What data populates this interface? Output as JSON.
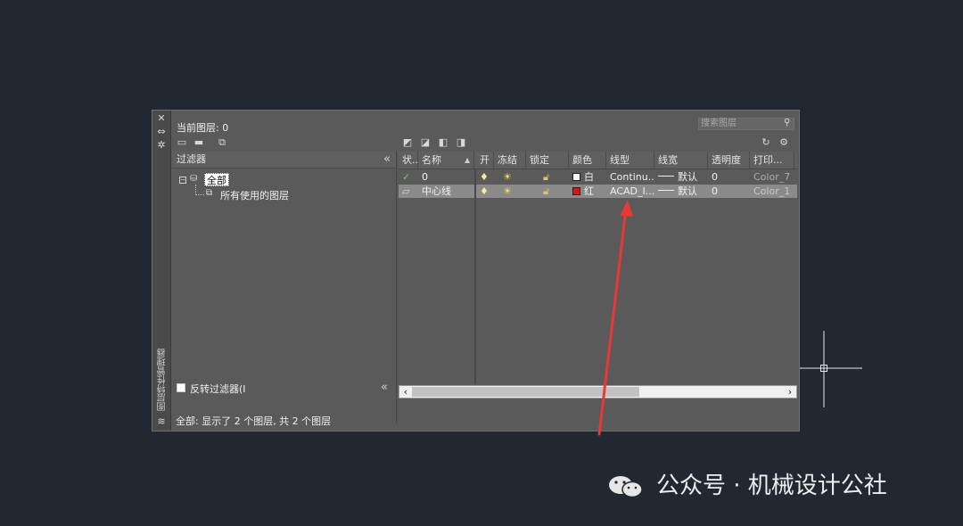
{
  "palette": {
    "title": "图层特性管理器",
    "current_layer": "当前图层: 0",
    "search_placeholder": "搜索图层"
  },
  "filters": {
    "header": "过滤器",
    "tree": {
      "root": "全部",
      "child": "所有使用的图层"
    },
    "invert_label": "反转过滤器(I",
    "invert_checked": false
  },
  "columns": [
    "状...",
    "名称",
    "开",
    "冻结",
    "锁定",
    "颜色",
    "线型",
    "线宽",
    "透明度",
    "打印..."
  ],
  "layers": [
    {
      "status": "current-check-icon",
      "name": "0",
      "on": "lightbulb-on",
      "freeze": "sun-thawed",
      "lock": "unlocked",
      "color_name": "白",
      "color_hex": "#ffffff",
      "linetype": "Continu...",
      "lineweight": "默认",
      "transparency": "0",
      "plot_style": "Color_7"
    },
    {
      "status": "layer-icon",
      "name": "中心线",
      "on": "lightbulb-on",
      "freeze": "sun-thawed",
      "lock": "unlocked",
      "color_name": "红",
      "color_hex": "#e01010",
      "linetype": "ACAD_I...",
      "lineweight": "默认",
      "transparency": "0",
      "plot_style": "Color_1"
    }
  ],
  "status_line": "全部: 显示了 2 个图层, 共 2 个图层",
  "watermark": "公众号 · 机械设计公社",
  "colors": {
    "background": "#212831",
    "palette": "#5a5a5a",
    "selected_row": "#8a8a8a",
    "arrow": "#e53935"
  }
}
